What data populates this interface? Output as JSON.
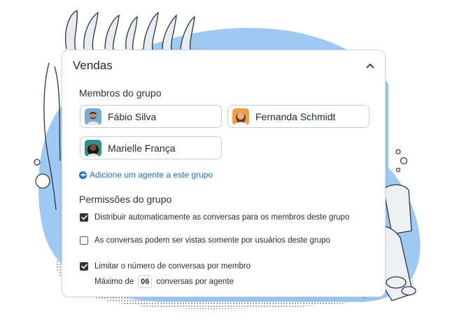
{
  "group": {
    "title": "Vendas",
    "collapse_icon": "chevron-up-icon"
  },
  "members": {
    "section_title": "Membros do grupo",
    "items": [
      {
        "name": "Fábio Silva",
        "avatar": "person-beard-avatar"
      },
      {
        "name": "Fernanda Schmidt",
        "avatar": "person-woman-avatar"
      },
      {
        "name": "Marielle França",
        "avatar": "person-woman-dark-avatar"
      }
    ],
    "add_label": "Adicione um agente a este grupo"
  },
  "permissions": {
    "section_title": "Permissões do grupo",
    "items": [
      {
        "label": "Distribuir automaticamente as conversas para os membros deste grupo",
        "checked": true
      },
      {
        "label": "As conversas podem ser vistas somente por usuários deste grupo",
        "checked": false
      },
      {
        "label": "Limitar o número de conversas por membro",
        "checked": true
      }
    ],
    "limit": {
      "prefix": "Máximo de",
      "value": "06",
      "suffix": "conversas por agente"
    }
  },
  "colors": {
    "accent": "#1f6fd1",
    "blob": "#9ec9f3",
    "checkbox": "#2c3641"
  }
}
